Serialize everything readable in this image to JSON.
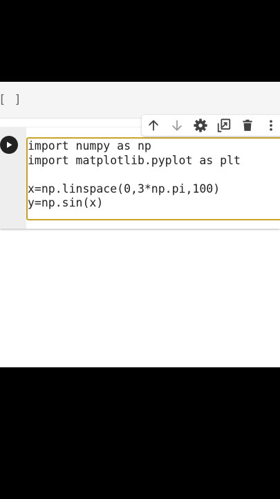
{
  "prev_cell": {
    "exec_count": "[ ]"
  },
  "toolbar": {
    "buttons": [
      {
        "icon": "arrow-up-icon",
        "label": "Move cell up"
      },
      {
        "icon": "arrow-down-icon",
        "label": "Move cell down"
      },
      {
        "icon": "gear-icon",
        "label": "Cell settings"
      },
      {
        "icon": "mirror-cell-icon",
        "label": "Mirror cell in tab"
      },
      {
        "icon": "trash-icon",
        "label": "Delete cell"
      },
      {
        "icon": "more-vert-icon",
        "label": "More cell actions"
      }
    ]
  },
  "cell": {
    "run_icon": "play-icon",
    "code_lines": [
      "import numpy as np",
      "import matplotlib.pyplot as plt",
      "",
      "x=np.linspace(0,3*np.pi,100)",
      "y=np.sin(x)"
    ]
  },
  "colors": {
    "focus_border": "#c9a227",
    "gutter": "#eeeeee",
    "run_button": "#212121",
    "icon": "#424242",
    "icon_disabled": "#9e9e9e"
  }
}
